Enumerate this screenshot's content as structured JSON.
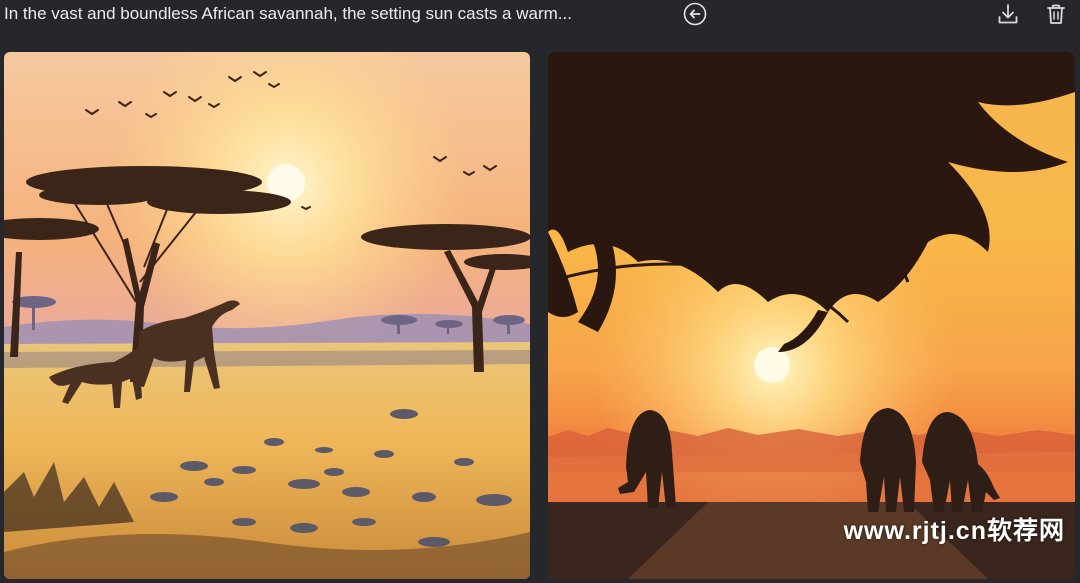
{
  "header": {
    "prompt_text": "In the vast and boundless African savannah, the setting sun casts a warm...",
    "icons": {
      "back": "arrow-left-circle-icon",
      "download": "download-icon",
      "delete": "trash-icon"
    }
  },
  "gallery": {
    "images": [
      {
        "style": "illustration",
        "subject": "savannah-sunset-cheetahs"
      },
      {
        "style": "photograph",
        "subject": "savannah-sunset-elephants"
      }
    ],
    "watermark": "www.rjtj.cn软荐网"
  }
}
